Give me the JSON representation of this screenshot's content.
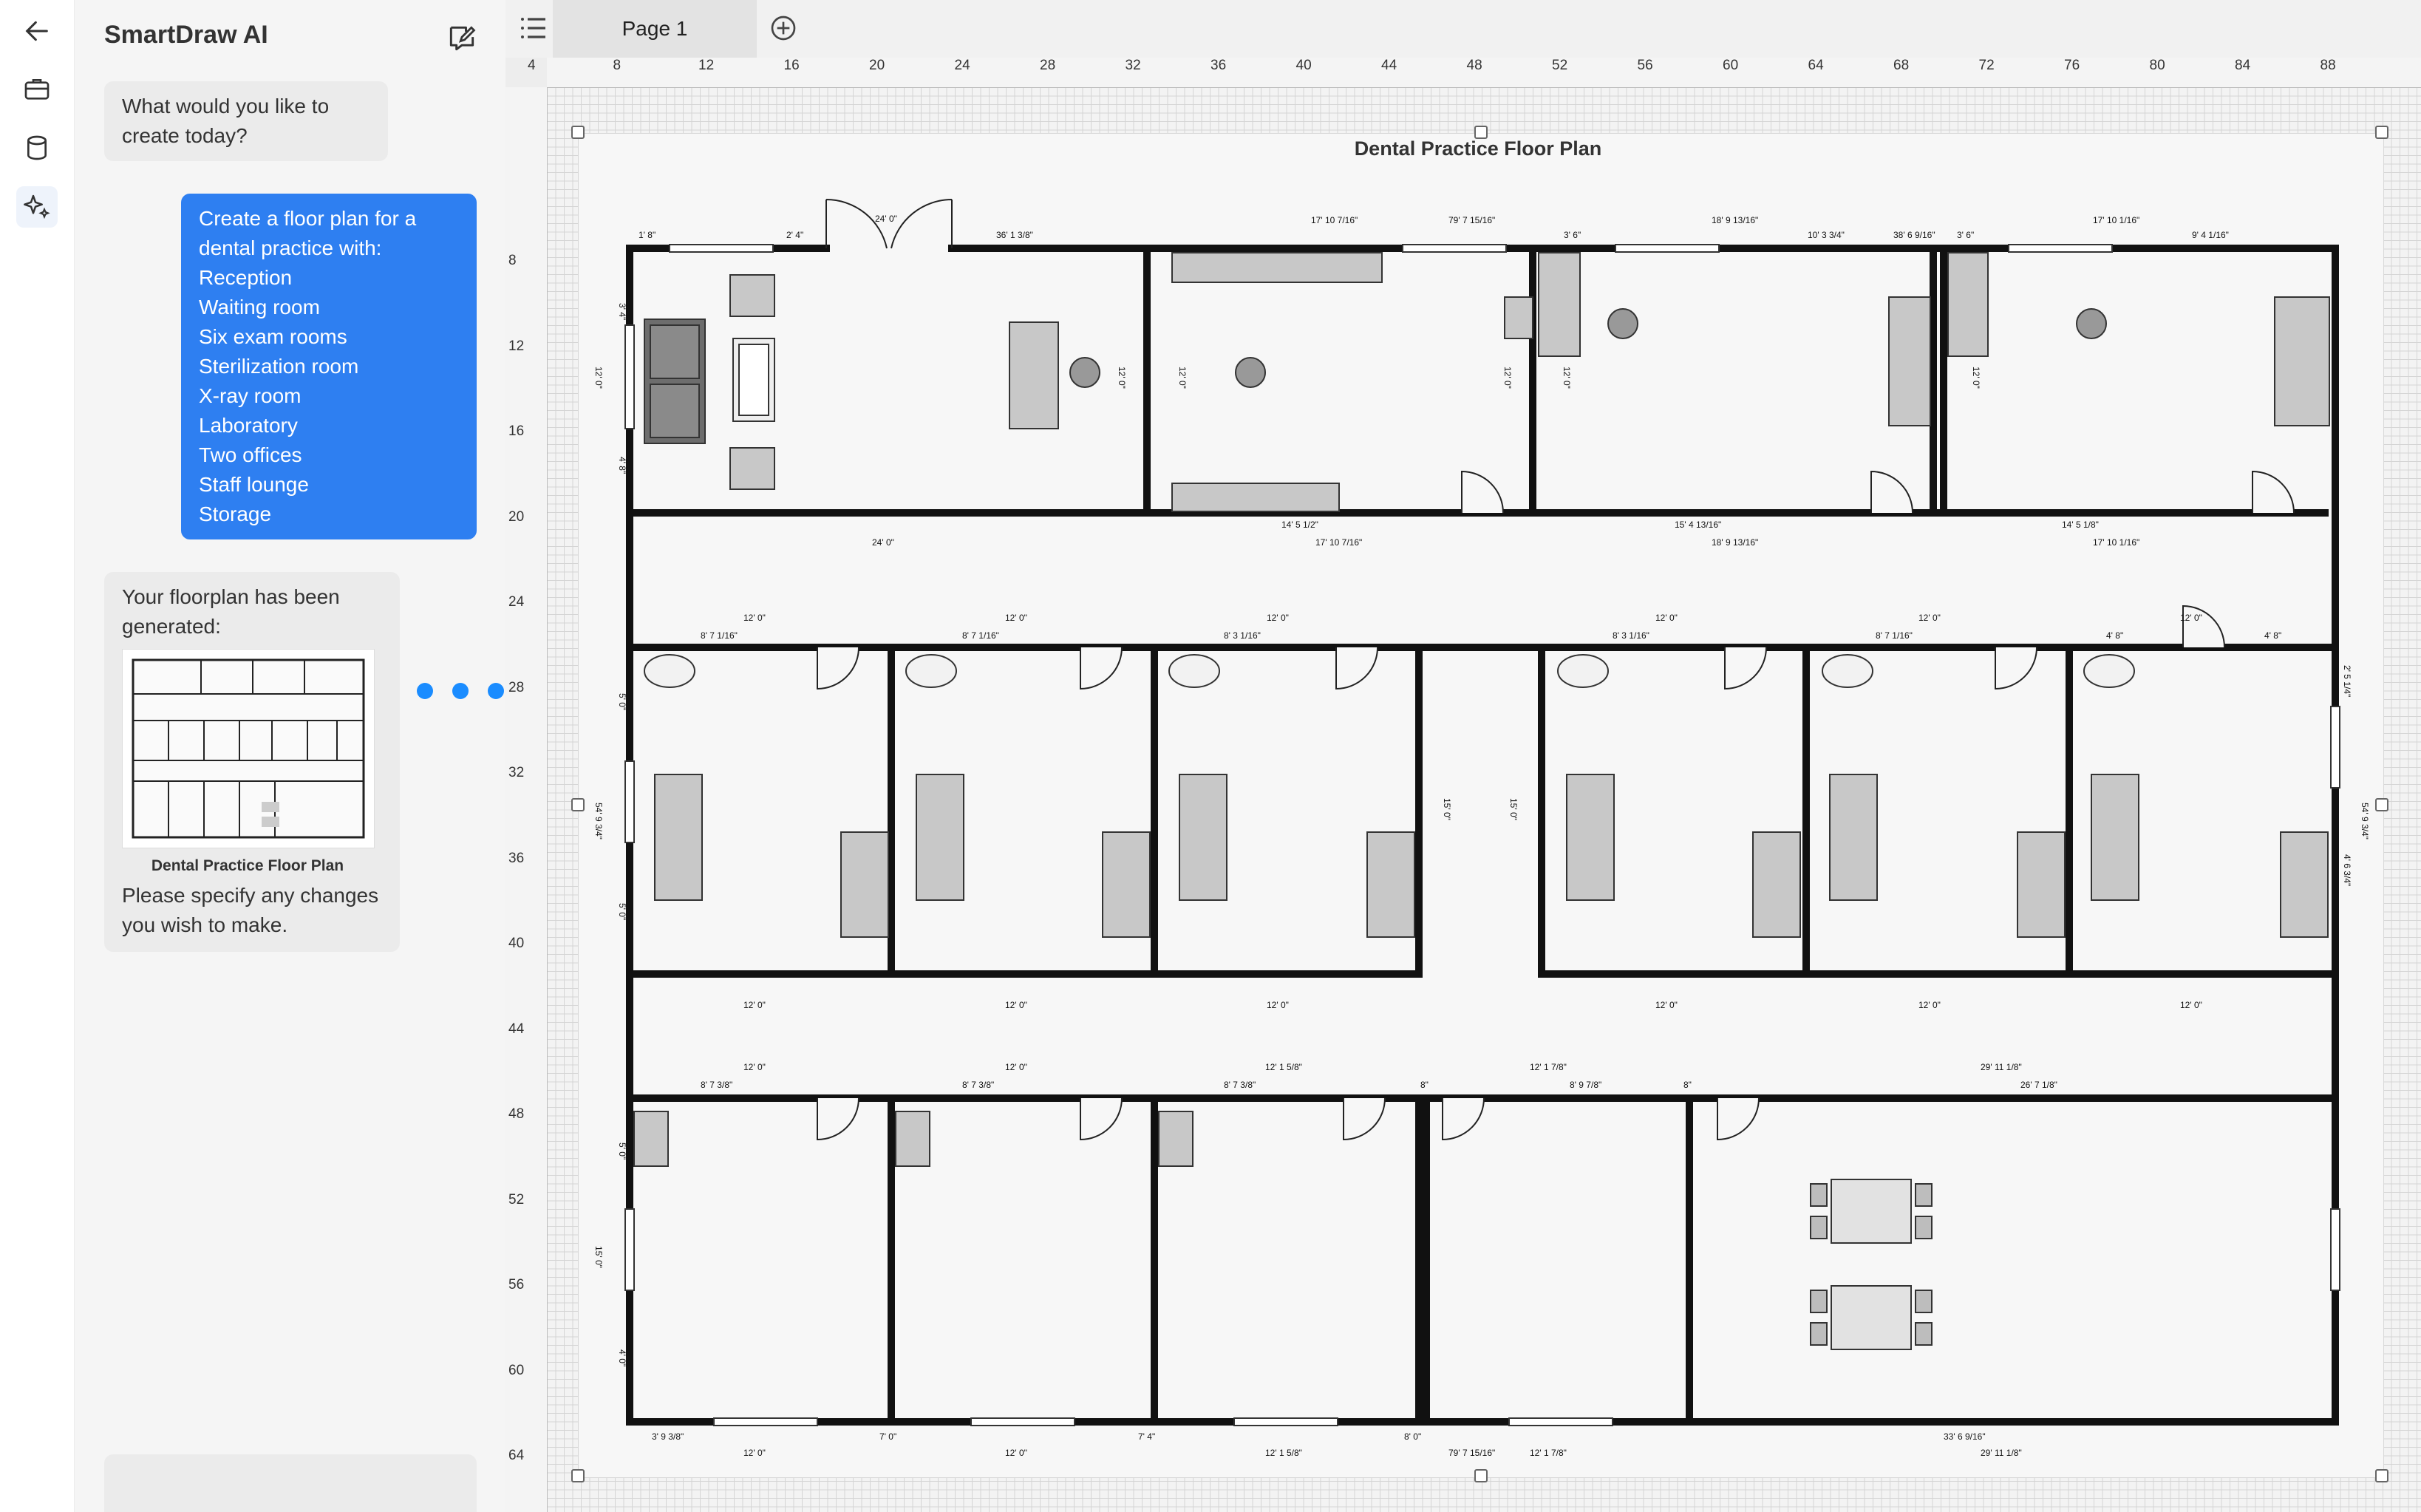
{
  "app": {
    "chat_title": "SmartDraw AI",
    "page_tab": "Page 1"
  },
  "chat": {
    "prompt_question": "What would you like to create today?",
    "request_lines": [
      "Create a floor plan for a dental practice with:",
      "Reception",
      "Waiting room",
      "Six exam rooms",
      "Sterilization room",
      "X-ray room",
      "Laboratory",
      "Two offices",
      "Staff lounge",
      "Storage"
    ],
    "response_intro": "Your floorplan has been generated:",
    "thumbnail_caption": "Dental Practice Floor Plan",
    "response_outro": "Please specify any changes you wish to make."
  },
  "rulers": {
    "horizontal": [
      "4",
      "8",
      "12",
      "16",
      "20",
      "24",
      "28",
      "32",
      "36",
      "40",
      "44",
      "48",
      "52",
      "56",
      "60",
      "64",
      "68",
      "72",
      "76",
      "80",
      "84",
      "88"
    ],
    "vertical": [
      "8",
      "12",
      "16",
      "20",
      "24",
      "28",
      "32",
      "36",
      "40",
      "44",
      "48",
      "52",
      "56",
      "60",
      "64"
    ]
  },
  "plan": {
    "title": "Dental Practice Floor Plan",
    "dimensions": {
      "top_row": [
        "1' 8\"",
        "2' 4\"",
        "24' 0\"",
        "36' 1 3/8\"",
        "17' 10 7/16\"",
        "79' 7 15/16\"",
        "3' 6\"",
        "18' 9 13/16\"",
        "10' 3 3/4\"",
        "38' 6 9/16\"",
        "3' 6\"",
        "17' 10 1/16\"",
        "9' 4 1/16\""
      ],
      "hall1": [
        "14' 5 1/2\"",
        "17' 10 7/16\"",
        "24' 0\"",
        "15' 4 13/16\"",
        "18' 9 13/16\"",
        "14' 5 1/8\"",
        "17' 10 1/16\""
      ],
      "exam_top": [
        "12' 0\"",
        "8' 7 1/16\"",
        "12' 0\"",
        "8' 7 1/16\"",
        "12' 0\"",
        "8' 3 1/16\"",
        "12' 0\"",
        "8' 3 1/16\"",
        "12' 0\"",
        "8' 7 1/16\"",
        "4' 8\"",
        "12' 0\"",
        "4' 8\""
      ],
      "hall2": [
        "12' 0\"",
        "12' 0\"",
        "12' 0\"",
        "12' 0\"",
        "12' 0\"",
        "12' 0\""
      ],
      "bottom_top": [
        "12' 0\"",
        "8' 7 3/8\"",
        "12' 0\"",
        "8' 7 3/8\"",
        "12' 1 5/8\"",
        "8' 7 3/8\"",
        "8\"",
        "12' 1 7/8\"",
        "8' 9 7/8\"",
        "8\"",
        "29' 11 1/8\"",
        "26' 7 1/8\""
      ],
      "bottom_row": [
        "3' 9 3/8\"",
        "7' 0\"",
        "7' 4\"",
        "8' 0\"",
        "33' 6 9/16\"",
        "12' 0\"",
        "12' 0\"",
        "12' 1 5/8\"",
        "79' 7 15/16\"",
        "12' 1 7/8\"",
        "29' 11 1/8\""
      ],
      "vertical": [
        "3' 4\"",
        "12' 0\"",
        "4' 8\"",
        "12' 0\"",
        "12' 0\"",
        "12' 0\"",
        "12' 0\"",
        "12' 0\"",
        "5' 0\"",
        "54' 9 3/4\"",
        "5' 0\"",
        "15' 0\"",
        "15' 0\"",
        "2' 5 1/4\"",
        "54' 9 3/4\"",
        "4' 6 3/4\"",
        "5' 0\"",
        "15' 0\"",
        "4' 0\""
      ]
    }
  }
}
